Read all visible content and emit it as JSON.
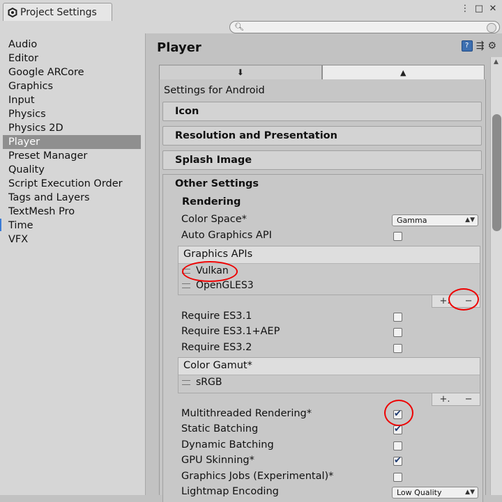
{
  "window": {
    "tab_title": "Project Settings",
    "search": {
      "placeholder": "",
      "value": ""
    }
  },
  "sidebar": {
    "items": [
      {
        "label": "Audio"
      },
      {
        "label": "Editor"
      },
      {
        "label": "Google ARCore"
      },
      {
        "label": "Graphics"
      },
      {
        "label": "Input"
      },
      {
        "label": "Physics"
      },
      {
        "label": "Physics 2D"
      },
      {
        "label": "Player",
        "selected": true
      },
      {
        "label": "Preset Manager"
      },
      {
        "label": "Quality"
      },
      {
        "label": "Script Execution Order"
      },
      {
        "label": "Tags and Layers"
      },
      {
        "label": "TextMesh Pro"
      },
      {
        "label": "Time"
      },
      {
        "label": "VFX"
      }
    ]
  },
  "main": {
    "title": "Player",
    "platform_tabs": [
      {
        "icon": "download-arrow-icon",
        "glyph": "⬇",
        "active": false
      },
      {
        "icon": "android-icon",
        "glyph": "🤖",
        "active": true
      }
    ],
    "settings_label": "Settings for Android",
    "foldouts": [
      "Icon",
      "Resolution and Presentation",
      "Splash Image"
    ],
    "other_settings": {
      "title": "Other Settings",
      "rendering_header": "Rendering",
      "color_space": {
        "label": "Color Space*",
        "value": "Gamma"
      },
      "auto_graphics_api": {
        "label": "Auto Graphics API",
        "checked": false
      },
      "graphics_apis": {
        "header": "Graphics APIs",
        "entries": [
          "Vulkan",
          "OpenGLES3"
        ]
      },
      "es_options": [
        {
          "label": "Require ES3.1",
          "checked": false
        },
        {
          "label": "Require ES3.1+AEP",
          "checked": false
        },
        {
          "label": "Require ES3.2",
          "checked": false
        }
      ],
      "color_gamut": {
        "header": "Color Gamut*",
        "entries": [
          "sRGB"
        ]
      },
      "toggles": [
        {
          "label": "Multithreaded Rendering*",
          "checked": true
        },
        {
          "label": "Static Batching",
          "checked": true
        },
        {
          "label": "Dynamic Batching",
          "checked": false
        },
        {
          "label": "GPU Skinning*",
          "checked": true
        },
        {
          "label": "Graphics Jobs (Experimental)*",
          "checked": false
        }
      ],
      "lightmap_encoding": {
        "label": "Lightmap Encoding",
        "value": "Low Quality"
      }
    }
  },
  "list_controls": {
    "add": "+.",
    "remove": "−"
  },
  "colors": {
    "annotation": "#e00000",
    "accent": "#3d6fb0",
    "selected_bg": "#8f8f8f"
  }
}
